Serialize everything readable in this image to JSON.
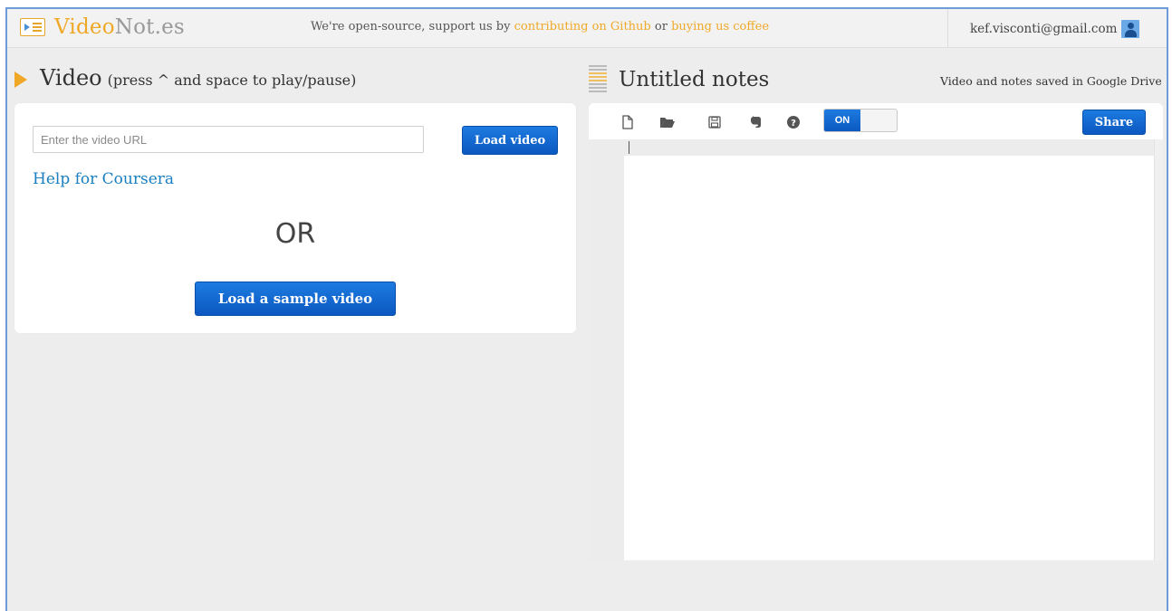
{
  "header": {
    "logo_prefix": "Video",
    "logo_suffix": "Not.es",
    "tagline_start": "We're open-source, support us by ",
    "tagline_link1": "contributing on Github",
    "tagline_mid": " or ",
    "tagline_link2": "buying us coffee",
    "user_email": "kef.visconti@gmail.com"
  },
  "video": {
    "title": "Video",
    "hint": "(press ^ and space to play/pause)",
    "url_placeholder": "Enter the video URL",
    "load_button": "Load video",
    "help_link": "Help for Coursera",
    "or_text": "OR",
    "sample_button": "Load a sample video"
  },
  "notes": {
    "title": "Untitled notes",
    "saved_text": "Video and notes saved in Google Drive",
    "toggle_label": "ON",
    "share_button": "Share",
    "tools": [
      "new-file-icon",
      "open-folder-icon",
      "save-icon",
      "evernote-icon",
      "help-icon"
    ]
  },
  "colors": {
    "accent_orange": "#f0a828",
    "button_blue": "#0b58c0",
    "link_blue": "#1a7fc1"
  }
}
